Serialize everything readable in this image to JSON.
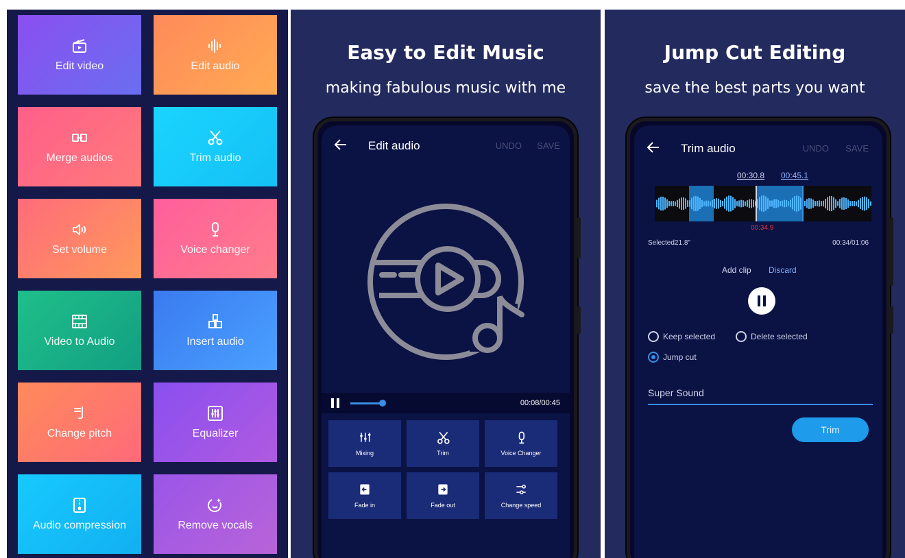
{
  "tools": [
    {
      "label": "Edit video",
      "icon": "film-icon",
      "bg": "linear-gradient(135deg,#8a4ff0,#6a6ef0)"
    },
    {
      "label": "Edit audio",
      "icon": "waveform-icon",
      "bg": "linear-gradient(135deg,#ff8a5a,#ffaa52)"
    },
    {
      "label": "Merge audios",
      "icon": "merge-icon",
      "bg": "linear-gradient(135deg,#ff5f8a,#ff7a7a)"
    },
    {
      "label": "Trim audio",
      "icon": "scissors-icon",
      "bg": "linear-gradient(135deg,#1ad4ff,#14c1f5)"
    },
    {
      "label": "Set volume",
      "icon": "speaker-icon",
      "bg": "linear-gradient(135deg,#ff6b7a,#ff9a5a)"
    },
    {
      "label": "Voice changer",
      "icon": "microphone-icon",
      "bg": "linear-gradient(135deg,#ff5f9c,#ff7c8a)"
    },
    {
      "label": "Video to Audio",
      "icon": "video-strip-icon",
      "bg": "linear-gradient(135deg,#1fbf8a,#129f82)"
    },
    {
      "label": "Insert audio",
      "icon": "insert-icon",
      "bg": "linear-gradient(135deg,#3a7bf0,#4aa0ff)"
    },
    {
      "label": "Change pitch",
      "icon": "pitch-icon",
      "bg": "linear-gradient(135deg,#ff8a5a,#ff6a7a)"
    },
    {
      "label": "Equalizer",
      "icon": "equalizer-icon",
      "bg": "linear-gradient(135deg,#8a4ff0,#b05ae0)"
    },
    {
      "label": "Audio compression",
      "icon": "zip-icon",
      "bg": "linear-gradient(135deg,#17c9ff,#12b0f0)"
    },
    {
      "label": "Remove vocals",
      "icon": "face-icon",
      "bg": "linear-gradient(135deg,#9a55e8,#b864d8)"
    }
  ],
  "edit_panel": {
    "title": "Easy to Edit Music",
    "subtitle": "making fabulous music with me",
    "screen_title": "Edit audio",
    "undo": "UNDO",
    "save": "SAVE",
    "time": "00:08/00:45",
    "tools": [
      {
        "label": "Mixing",
        "icon": "mixing-icon"
      },
      {
        "label": "Trim",
        "icon": "scissors-icon"
      },
      {
        "label": "Voice Changer",
        "icon": "microphone-icon"
      },
      {
        "label": "Fade in",
        "icon": "fade-in-icon"
      },
      {
        "label": "Fade out",
        "icon": "fade-out-icon"
      },
      {
        "label": "Change speed",
        "icon": "speed-icon"
      }
    ]
  },
  "trim_panel": {
    "title": "Jump Cut Editing",
    "subtitle": "save the best parts you want",
    "screen_title": "Trim audio",
    "undo": "UNDO",
    "save": "SAVE",
    "marker_start": "00:30.8",
    "marker_end": "00:45.1",
    "cursor_time": "00:34.9",
    "selected": "Selected21.8\"",
    "position": "00:34/01:06",
    "add_clip": "Add clip",
    "discard": "Discard",
    "options": [
      {
        "label": "Keep selected",
        "checked": false
      },
      {
        "label": "Delete selected",
        "checked": false
      },
      {
        "label": "Jump cut",
        "checked": true
      }
    ],
    "file_name": "Super Sound",
    "trim_button": "Trim"
  }
}
